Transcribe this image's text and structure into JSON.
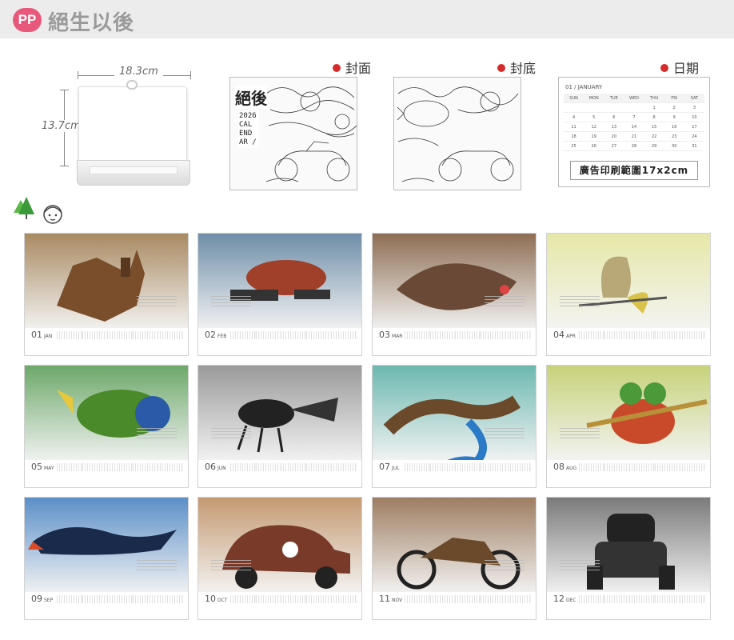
{
  "header": {
    "badge": "PP",
    "title": "絕生以後"
  },
  "product": {
    "width_label": "18.3cm",
    "height_label": "13.7cm"
  },
  "previews": [
    {
      "label": "封面",
      "cover_title": "絕後",
      "cover_year": "2026 CAL END AR /"
    },
    {
      "label": "封底"
    },
    {
      "label": "日期"
    }
  ],
  "date_card": {
    "month_label": "01 / JANUARY",
    "ad_area": "廣告印刷範圍17x2cm"
  },
  "months": [
    {
      "num": "01",
      "abbr": "JAN",
      "bg": "#a98a62",
      "creature": "mechanical-cat"
    },
    {
      "num": "02",
      "abbr": "FEB",
      "bg": "#6f8ea8",
      "creature": "mechanical-turtle"
    },
    {
      "num": "03",
      "abbr": "MAR",
      "bg": "#8e6e54",
      "creature": "mechanical-fish"
    },
    {
      "num": "04",
      "abbr": "APR",
      "bg": "#e6e8a8",
      "creature": "mechanical-butterfly"
    },
    {
      "num": "05",
      "abbr": "MAY",
      "bg": "#6da86a",
      "creature": "mechanical-bird"
    },
    {
      "num": "06",
      "abbr": "JUN",
      "bg": "#9a9a9a",
      "creature": "mechanical-beetle"
    },
    {
      "num": "07",
      "abbr": "JUL",
      "bg": "#6cb8b0",
      "creature": "mechanical-lizard"
    },
    {
      "num": "08",
      "abbr": "AUG",
      "bg": "#c8d27a",
      "creature": "mechanical-frog"
    },
    {
      "num": "09",
      "abbr": "SEP",
      "bg": "#5c8fc8",
      "creature": "mechanical-shark-bird"
    },
    {
      "num": "10",
      "abbr": "OCT",
      "bg": "#c49a72",
      "creature": "vintage-car"
    },
    {
      "num": "11",
      "abbr": "NOV",
      "bg": "#9e7e62",
      "creature": "motorcycle"
    },
    {
      "num": "12",
      "abbr": "DEC",
      "bg": "#7a7a7a",
      "creature": "mechanical-gorilla"
    }
  ]
}
